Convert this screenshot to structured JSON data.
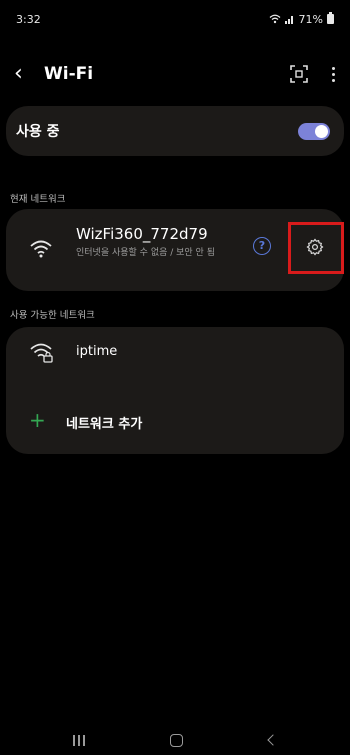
{
  "status_bar": {
    "time": "3:32",
    "signal_text": "ल",
    "battery_text": "71%"
  },
  "header": {
    "back_icon": "chevron-left-icon",
    "title": "Wi-Fi",
    "qr_icon": "qr-scan-icon",
    "more_icon": "more-vert-icon"
  },
  "wifi_toggle": {
    "label": "사용 중",
    "enabled": true,
    "accent_color": "#7c82d8"
  },
  "current_network": {
    "section_label": "현재 네트워크",
    "name": "WizFi360_772d79",
    "status": "인터넷을 사용할 수 없음 / 보안 안 됨",
    "help_icon": "help-circle-icon",
    "help_text": "?",
    "settings_icon": "gear-icon",
    "highlight_color": "#d81b1b"
  },
  "available_networks": {
    "section_label": "사용 가능한 네트워크",
    "items": [
      {
        "name": "iptime",
        "icon": "wifi-lock-icon"
      }
    ],
    "add_network": {
      "label": "네트워크 추가",
      "icon": "plus-icon",
      "color": "#34a853"
    }
  },
  "nav_bar": {
    "recent_icon": "recent-apps-icon",
    "home_icon": "home-icon",
    "back_icon": "back-icon"
  }
}
